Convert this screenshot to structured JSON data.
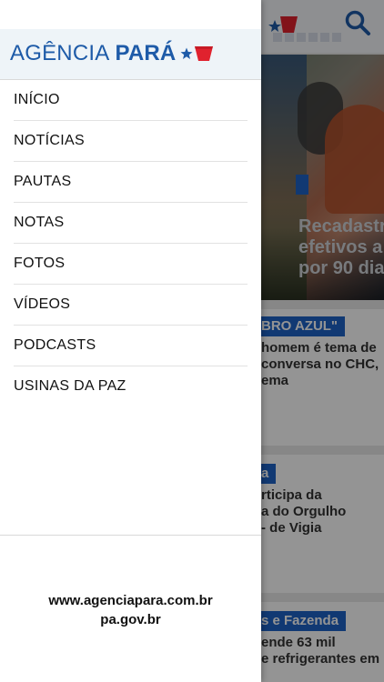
{
  "brand": {
    "name_light": "AGÊNCIA",
    "name_bold": "PARÁ",
    "star_color": "#1e5ba8",
    "flag_color": "#e0222e"
  },
  "menu": {
    "items": [
      {
        "label": "INÍCIO"
      },
      {
        "label": "NOTÍCIAS"
      },
      {
        "label": "PAUTAS"
      },
      {
        "label": "NOTAS"
      },
      {
        "label": "FOTOS"
      },
      {
        "label": "VÍDEOS"
      },
      {
        "label": "PODCASTS"
      },
      {
        "label": "USINAS DA PAZ"
      }
    ]
  },
  "footer": {
    "links": [
      "www.agenciapara.com.br",
      "pa.gov.br"
    ]
  },
  "background": {
    "hero_text": [
      "Recadastr",
      "efetivos a",
      "por 90 dia"
    ],
    "cards": [
      {
        "badge": "BRO AZUL\"",
        "lines": [
          "homem é tema de",
          "conversa no CHC,",
          "ema"
        ]
      },
      {
        "badge": "a",
        "lines": [
          "rticipa da",
          "a do Orgulho",
          "- de Vigia"
        ]
      },
      {
        "badge": "s e Fazenda",
        "lines": [
          "ende 63 mil",
          "e refrigerantes em"
        ]
      }
    ]
  },
  "colors": {
    "accent_blue": "#1e63c6",
    "brand_blue": "#1e5ba8",
    "brand_red": "#e0222e"
  }
}
